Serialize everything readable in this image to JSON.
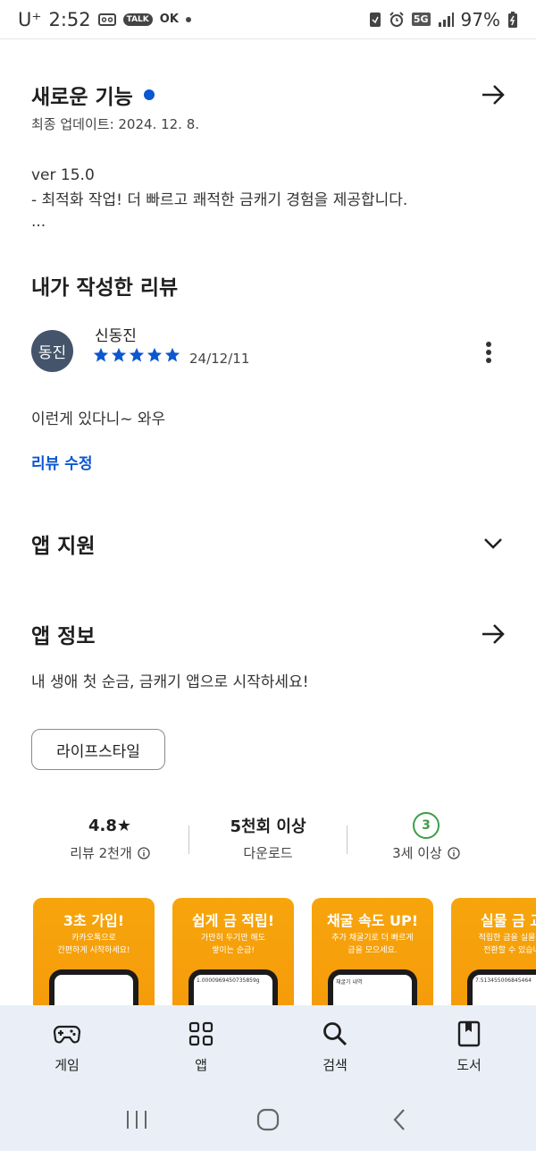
{
  "status_bar": {
    "carrier": "U⁺",
    "time": "2:52",
    "talk_badge": "TALK",
    "ok_badge": "OK",
    "network": "5G",
    "battery": "97%"
  },
  "whats_new": {
    "title": "새로운 기능",
    "updated": "최종 업데이트: 2024. 12. 8.",
    "version": "ver 15.0",
    "note": "- 최적화 작업! 더 빠르고 쾌적한 금캐기 경험을 제공합니다.",
    "ellipsis": "..."
  },
  "my_review": {
    "title": "내가 작성한 리뷰",
    "avatar_text": "동진",
    "reviewer": "신동진",
    "rating": 5,
    "date": "24/12/11",
    "text": "이런게 있다니~ 와우",
    "edit_label": "리뷰 수정"
  },
  "app_support": {
    "title": "앱 지원"
  },
  "app_info": {
    "title": "앱 정보",
    "description": "내 생애 첫 순금, 금캐기 앱으로 시작하세요!",
    "category": "라이프스타일"
  },
  "stats": {
    "rating_value": "4.8★",
    "rating_label": "리뷰 2천개",
    "downloads_value": "5천회 이상",
    "downloads_label": "다운로드",
    "age_value": "3",
    "age_label": "3세 이상"
  },
  "screenshots": [
    {
      "title": "3초 가입!",
      "desc": "카카오톡으로\n간편하게 시작하세요!",
      "screen": ""
    },
    {
      "title": "쉽게 금 적립!",
      "desc": "가만히 두기만 해도\n쌓이는 순금!",
      "screen": "1.0000969450735859g"
    },
    {
      "title": "채굴 속도 UP!",
      "desc": "추가 채굴기로 더 빠르게\n금을 모으세요.",
      "screen": "채굴기 내역"
    },
    {
      "title": "실물 금 교",
      "desc": "적립한 금을 실물 금\n전환할 수 있습니",
      "screen": "7.513455006845464"
    }
  ],
  "bottom_nav": [
    {
      "label": "게임",
      "icon": "gamepad-icon"
    },
    {
      "label": "앱",
      "icon": "apps-grid-icon"
    },
    {
      "label": "검색",
      "icon": "search-icon"
    },
    {
      "label": "도서",
      "icon": "book-icon"
    }
  ],
  "colors": {
    "accent": "#0b57d0",
    "age_badge": "#3b9e48",
    "screenshot_bg": "#f7a50c",
    "nav_bg": "#eaeff7"
  }
}
